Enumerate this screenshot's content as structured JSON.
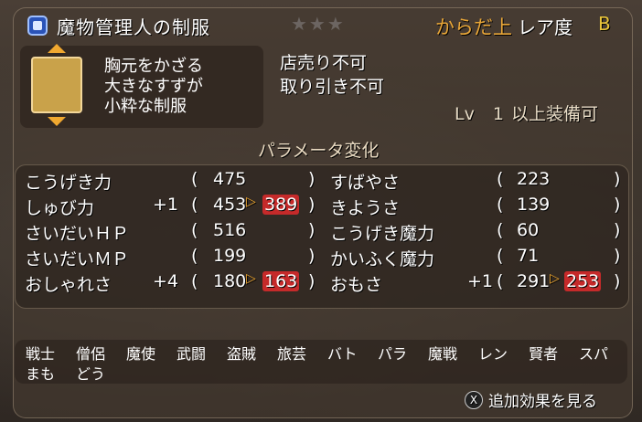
{
  "title": "魔物管理人の制服",
  "slot": "からだ上",
  "rarity_label": "レア度",
  "rarity": "B",
  "description": [
    "胸元をかざる",
    "大きなすずが",
    "小粋な制服"
  ],
  "trade": [
    "店売り不可",
    "取り引き不可"
  ],
  "level": {
    "label": "Lv",
    "value": "1",
    "suffix": "以上装備可"
  },
  "param_title": "パラメータ変化",
  "stats": [
    {
      "name": "こうげき力",
      "bonus": "",
      "open": "(",
      "value": "475",
      "arrow": "",
      "new": "",
      "close": ")"
    },
    {
      "name": "しゅび力",
      "bonus": "+1",
      "open": "(",
      "value": "453",
      "arrow": "▷",
      "new": "389",
      "close": ")"
    },
    {
      "name": "さいだいＨＰ",
      "bonus": "",
      "open": "(",
      "value": "516",
      "arrow": "",
      "new": "",
      "close": ")"
    },
    {
      "name": "さいだいＭＰ",
      "bonus": "",
      "open": "(",
      "value": "199",
      "arrow": "",
      "new": "",
      "close": ")"
    },
    {
      "name": "おしゃれさ",
      "bonus": "+4",
      "open": "(",
      "value": "180",
      "arrow": "▷",
      "new": "163",
      "close": ")"
    },
    {
      "name": "すばやさ",
      "bonus": "",
      "open": "(",
      "value": "223",
      "arrow": "",
      "new": "",
      "close": ")"
    },
    {
      "name": "きようさ",
      "bonus": "",
      "open": "(",
      "value": "139",
      "arrow": "",
      "new": "",
      "close": ")"
    },
    {
      "name": "こうげき魔力",
      "bonus": "",
      "open": "(",
      "value": "60",
      "arrow": "",
      "new": "",
      "close": ")"
    },
    {
      "name": "かいふく魔力",
      "bonus": "",
      "open": "(",
      "value": "71",
      "arrow": "",
      "new": "",
      "close": ")"
    },
    {
      "name": "おもさ",
      "bonus": "+1",
      "open": "(",
      "value": "291",
      "arrow": "▷",
      "new": "253",
      "close": ")"
    }
  ],
  "jobs_row1": [
    "戦士",
    "僧侶",
    "魔使",
    "武闘",
    "盗賊",
    "旅芸",
    "バト",
    "パラ",
    "魔戦",
    "レン",
    "賢者",
    "スパ"
  ],
  "jobs_row2": [
    "まも",
    "どう"
  ],
  "footer": {
    "button": "X",
    "label": "追加効果を見る"
  },
  "stars": "★★★"
}
